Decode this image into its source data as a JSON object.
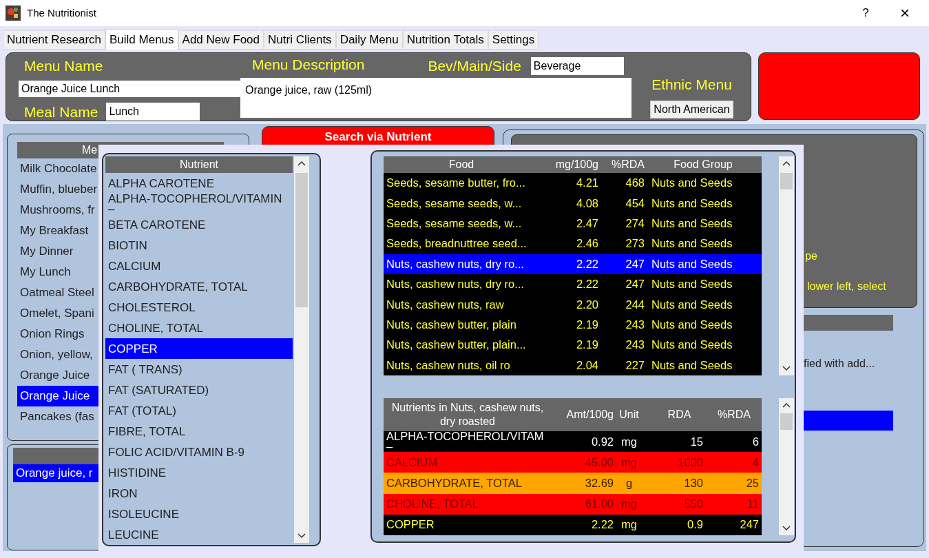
{
  "window": {
    "title": "The Nutritionist",
    "help": "?",
    "close": "×"
  },
  "tabs": [
    {
      "label": "Nutrient Research",
      "selected": false
    },
    {
      "label": "Build Menus",
      "selected": true
    },
    {
      "label": "Add New Food",
      "selected": false
    },
    {
      "label": "Nutri Clients",
      "selected": false
    },
    {
      "label": "Daily Menu",
      "selected": false
    },
    {
      "label": "Nutrition Totals",
      "selected": false
    },
    {
      "label": "Settings",
      "selected": false
    }
  ],
  "menu_form": {
    "menu_name_label": "Menu Name",
    "menu_name": "Orange Juice Lunch",
    "meal_name_label": "Meal Name",
    "meal_name": "Lunch",
    "description_label": "Menu Description",
    "description": "Orange juice, raw (125ml)",
    "bev_main_side_label": "Bev/Main/Side",
    "bev_main_side": "Beverage",
    "ethnic_label": "Ethnic Menu",
    "ethnic": "North American"
  },
  "menus": {
    "header": "Me",
    "items": [
      {
        "text": "Milk Chocolate",
        "selected": false
      },
      {
        "text": "Muffin, blueber",
        "selected": false
      },
      {
        "text": "Mushrooms, fr",
        "selected": false
      },
      {
        "text": "My Breakfast",
        "selected": false
      },
      {
        "text": "My Dinner",
        "selected": false
      },
      {
        "text": "My Lunch",
        "selected": false
      },
      {
        "text": "Oatmeal Steel",
        "selected": false
      },
      {
        "text": "Omelet, Spani",
        "selected": false
      },
      {
        "text": "Onion Rings",
        "selected": false
      },
      {
        "text": "Onion, yellow,",
        "selected": false
      },
      {
        "text": "Orange Juice",
        "selected": false
      },
      {
        "text": "Orange Juice",
        "selected": true
      },
      {
        "text": "Pancakes (fas",
        "selected": false
      }
    ]
  },
  "menu_foods": {
    "items": [
      {
        "text": "Orange juice, r",
        "selected": true
      }
    ]
  },
  "search_button": "Search via Nutrient",
  "edit_panel": {
    "text_1": "pe",
    "text_2": "lower left, select",
    "text_3": "fied with add..."
  },
  "nutrient_list": {
    "header": "Nutrient",
    "items": [
      {
        "text": "ALPHA CAROTENE",
        "selected": false
      },
      {
        "text": "ALPHA-TOCOPHEROL/VITAMIN\n–",
        "selected": false
      },
      {
        "text": "BETA CAROTENE",
        "selected": false
      },
      {
        "text": "BIOTIN",
        "selected": false
      },
      {
        "text": "CALCIUM",
        "selected": false
      },
      {
        "text": "CARBOHYDRATE, TOTAL",
        "selected": false
      },
      {
        "text": "CHOLESTEROL",
        "selected": false
      },
      {
        "text": "CHOLINE, TOTAL",
        "selected": false
      },
      {
        "text": "COPPER",
        "selected": true
      },
      {
        "text": "FAT ( TRANS)",
        "selected": false
      },
      {
        "text": "FAT (SATURATED)",
        "selected": false
      },
      {
        "text": "FAT (TOTAL)",
        "selected": false
      },
      {
        "text": "FIBRE, TOTAL",
        "selected": false
      },
      {
        "text": "FOLIC ACID/VITAMIN B-9",
        "selected": false
      },
      {
        "text": "HISTIDINE",
        "selected": false
      },
      {
        "text": "IRON",
        "selected": false
      },
      {
        "text": "ISOLEUCINE",
        "selected": false
      },
      {
        "text": "LEUCINE",
        "selected": false
      }
    ]
  },
  "food_table": {
    "columns": [
      "Food",
      "mg/100g",
      "%RDA",
      "Food Group"
    ],
    "rows": [
      {
        "cells": [
          "Seeds, sesame butter, fro...",
          "4.21",
          "468",
          "Nuts and Seeds"
        ],
        "selected": false
      },
      {
        "cells": [
          "Seeds, sesame seeds, w...",
          "4.08",
          "454",
          "Nuts and Seeds"
        ],
        "selected": false
      },
      {
        "cells": [
          "Seeds, sesame seeds, w...",
          "2.47",
          "274",
          "Nuts and Seeds"
        ],
        "selected": false
      },
      {
        "cells": [
          "Seeds, breadnuttree seed...",
          "2.46",
          "273",
          "Nuts and Seeds"
        ],
        "selected": false
      },
      {
        "cells": [
          "Nuts, cashew nuts, dry ro...",
          "2.22",
          "247",
          "Nuts and Seeds"
        ],
        "selected": true
      },
      {
        "cells": [
          "Nuts, cashew nuts, dry ro...",
          "2.22",
          "247",
          "Nuts and Seeds"
        ],
        "selected": false
      },
      {
        "cells": [
          "Nuts, cashew nuts, raw",
          "2.20",
          "244",
          "Nuts and Seeds"
        ],
        "selected": false
      },
      {
        "cells": [
          "Nuts, cashew butter, plain",
          "2.19",
          "243",
          "Nuts and Seeds"
        ],
        "selected": false
      },
      {
        "cells": [
          "Nuts, cashew butter, plain...",
          "2.19",
          "243",
          "Nuts and Seeds"
        ],
        "selected": false
      },
      {
        "cells": [
          "Nuts, cashew nuts, oil ro",
          "2.04",
          "227",
          "Nuts and Seeds"
        ],
        "selected": false
      }
    ]
  },
  "nutrients_table": {
    "columns": [
      "Nutrients in Nuts, cashew nuts, dry roasted",
      "Amt/100g",
      "Unit",
      "RDA",
      "%RDA"
    ],
    "rows": [
      {
        "cells": [
          "ALPHA-TOCOPHEROL/VITAM\n–",
          "0.92",
          "mg",
          "15",
          "6"
        ],
        "color": "#000000",
        "selected": false
      },
      {
        "cells": [
          "CALCIUM",
          "45.00",
          "mg",
          "1000",
          "4"
        ],
        "color": "#ff0000",
        "selected": false
      },
      {
        "cells": [
          "CARBOHYDRATE, TOTAL",
          "32.69",
          "g",
          "130",
          "25"
        ],
        "color": "#ffa500",
        "selected": false
      },
      {
        "cells": [
          "CHOLINE, TOTAL",
          "61.00",
          "mg",
          "550",
          "11"
        ],
        "color": "#ff0000",
        "selected": false
      },
      {
        "cells": [
          "COPPER",
          "2.22",
          "mg",
          "0.9",
          "247"
        ],
        "color": "#000000",
        "selected": true
      }
    ]
  }
}
